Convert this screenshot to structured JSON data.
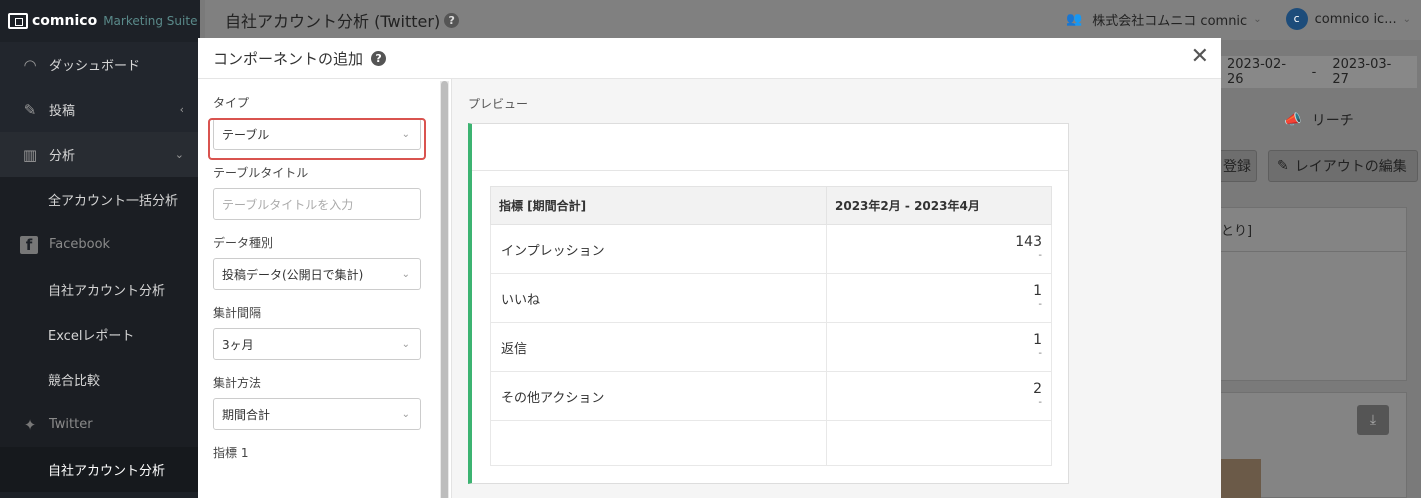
{
  "brand": {
    "name": "comnico",
    "sub": "Marketing Suite"
  },
  "sidebar": {
    "items": [
      {
        "label": "ダッシュボード",
        "icon": "gauge-icon",
        "glyph": "◠"
      },
      {
        "label": "投稿",
        "icon": "pencil-icon",
        "glyph": "✎"
      },
      {
        "label": "分析",
        "icon": "bar-chart-icon",
        "glyph": "▥"
      },
      {
        "label": "全アカウント一括分析"
      },
      {
        "label": "Facebook",
        "icon": "facebook-icon",
        "glyph": "f"
      },
      {
        "label": "自社アカウント分析"
      },
      {
        "label": "Excelレポート"
      },
      {
        "label": "競合比較"
      },
      {
        "label": "Twitter",
        "icon": "twitter-icon",
        "glyph": "🐦"
      },
      {
        "label": "自社アカウント分析"
      }
    ]
  },
  "header": {
    "title": "自社アカウント分析 (Twitter)",
    "company": "株式会社コムニコ comnic",
    "user_initial": "c",
    "user_name": "comnico ic..."
  },
  "background": {
    "date_start": "2023-02-26",
    "date_sep": "-",
    "date_end": "2023-03-27",
    "reach_tab": "リーチ",
    "register_btn": "登録",
    "edit_layout_btn": "レイアウトの編集",
    "card_text": "とり]"
  },
  "modal": {
    "title": "コンポーネントの追加",
    "form": {
      "type_label": "タイプ",
      "type_value": "テーブル",
      "table_title_label": "テーブルタイトル",
      "table_title_placeholder": "テーブルタイトルを入力",
      "data_kind_label": "データ種別",
      "data_kind_value": "投稿データ(公開日で集計)",
      "interval_label": "集計間隔",
      "interval_value": "3ヶ月",
      "method_label": "集計方法",
      "method_value": "期間合計",
      "metric1_label": "指標 1"
    },
    "preview": {
      "label": "プレビュー",
      "table": {
        "headers": [
          "指標 [期間合計]",
          "2023年2月 - 2023年4月"
        ],
        "rows": [
          {
            "metric": "インプレッション",
            "value": "143",
            "diff": "-"
          },
          {
            "metric": "いいね",
            "value": "1",
            "diff": "-"
          },
          {
            "metric": "返信",
            "value": "1",
            "diff": "-"
          },
          {
            "metric": "その他アクション",
            "value": "2",
            "diff": "-"
          }
        ]
      }
    }
  },
  "colors": {
    "accent_green": "#3cb371",
    "highlight_red": "#d9534f",
    "sidebar_bg": "#1d2127"
  }
}
